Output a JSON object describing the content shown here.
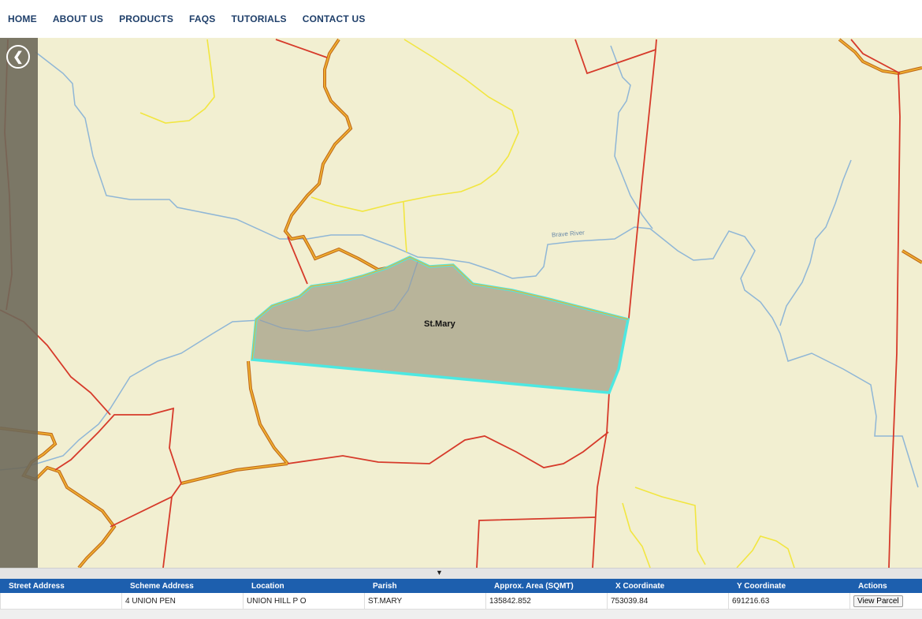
{
  "nav": {
    "items": [
      "HOME",
      "ABOUT US",
      "PRODUCTS",
      "FAQS",
      "TUTORIALS",
      "CONTACT US"
    ]
  },
  "map": {
    "parcel_label": "St.Mary",
    "river_label": "Brave River",
    "back_icon": "chevron-left-icon",
    "collapse_icon": "triangle-down-icon",
    "colors": {
      "land": "#f2efd1",
      "parcel_fill": "#b8b49a",
      "parcel_outline": "#4de8e2",
      "boundary": "#d63a2a",
      "road": "#e8a020",
      "minor_road": "#f2e640",
      "river": "#8fb6d6"
    }
  },
  "splitter": {
    "glyph": "▼"
  },
  "results": {
    "columns": [
      "Street Address",
      "Scheme Address",
      "Location",
      "Parish",
      "Approx. Area (SQMT)",
      "X Coordinate",
      "Y Coordinate",
      "Actions"
    ],
    "rows": [
      {
        "street_address": "",
        "scheme_address": "4 UNION PEN",
        "location": "UNION HILL P O",
        "parish": "ST.MARY",
        "area": "135842.852",
        "x_coordinate": "753039.84",
        "y_coordinate": "691216.63",
        "action_label": "View Parcel"
      }
    ]
  }
}
